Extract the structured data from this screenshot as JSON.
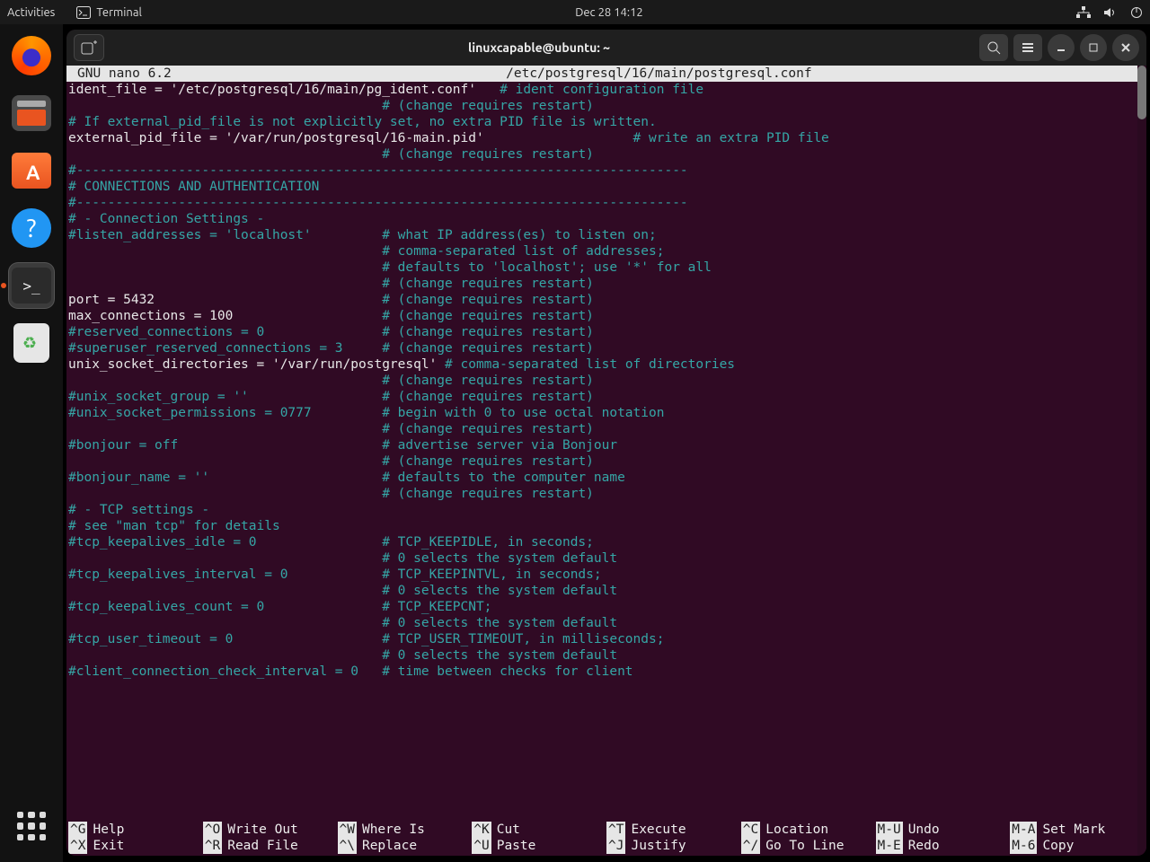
{
  "topbar": {
    "activities": "Activities",
    "app_label": "Terminal",
    "datetime": "Dec 28  14:12"
  },
  "dock": {
    "items": [
      {
        "name": "firefox-launcher"
      },
      {
        "name": "files-launcher"
      },
      {
        "name": "software-launcher"
      },
      {
        "name": "help-launcher"
      },
      {
        "name": "terminal-launcher"
      },
      {
        "name": "trash-launcher"
      }
    ]
  },
  "window": {
    "title": "linuxcapable@ubuntu: ~"
  },
  "nano": {
    "app": "  GNU nano  6.2",
    "filepath": "/etc/postgresql/16/main/postgresql.conf"
  },
  "lines": [
    {
      "segs": [
        [
          "plain",
          "ident_file = '/etc/postgresql/16/main/pg_ident.conf'   "
        ],
        [
          "comment",
          "# ident configuration file"
        ]
      ]
    },
    {
      "segs": [
        [
          "plain",
          "                                        "
        ],
        [
          "comment",
          "# (change requires restart)"
        ]
      ]
    },
    {
      "segs": [
        [
          "plain",
          ""
        ]
      ]
    },
    {
      "segs": [
        [
          "comment",
          "# If external_pid_file is not explicitly set, no extra PID file is written."
        ]
      ]
    },
    {
      "segs": [
        [
          "plain",
          "external_pid_file = '/var/run/postgresql/16-main.pid'                   "
        ],
        [
          "comment",
          "# write an extra PID file"
        ]
      ]
    },
    {
      "segs": [
        [
          "plain",
          "                                        "
        ],
        [
          "comment",
          "# (change requires restart)"
        ]
      ]
    },
    {
      "segs": [
        [
          "plain",
          ""
        ]
      ]
    },
    {
      "segs": [
        [
          "plain",
          ""
        ]
      ]
    },
    {
      "segs": [
        [
          "comment",
          "#------------------------------------------------------------------------------"
        ]
      ]
    },
    {
      "segs": [
        [
          "comment",
          "# CONNECTIONS AND AUTHENTICATION"
        ]
      ]
    },
    {
      "segs": [
        [
          "comment",
          "#------------------------------------------------------------------------------"
        ]
      ]
    },
    {
      "segs": [
        [
          "plain",
          ""
        ]
      ]
    },
    {
      "segs": [
        [
          "comment",
          "# - Connection Settings -"
        ]
      ]
    },
    {
      "segs": [
        [
          "plain",
          ""
        ]
      ]
    },
    {
      "segs": [
        [
          "comment",
          "#listen_addresses = 'localhost'         # what IP address(es) to listen on;"
        ]
      ]
    },
    {
      "segs": [
        [
          "plain",
          "                                        "
        ],
        [
          "comment",
          "# comma-separated list of addresses;"
        ]
      ]
    },
    {
      "segs": [
        [
          "plain",
          "                                        "
        ],
        [
          "comment",
          "# defaults to 'localhost'; use '*' for all"
        ]
      ]
    },
    {
      "segs": [
        [
          "plain",
          "                                        "
        ],
        [
          "comment",
          "# (change requires restart)"
        ]
      ]
    },
    {
      "segs": [
        [
          "plain",
          "port = 5432                             "
        ],
        [
          "comment",
          "# (change requires restart)"
        ]
      ]
    },
    {
      "segs": [
        [
          "plain",
          "max_connections = 100                   "
        ],
        [
          "comment",
          "# (change requires restart)"
        ]
      ]
    },
    {
      "segs": [
        [
          "comment",
          "#reserved_connections = 0               # (change requires restart)"
        ]
      ]
    },
    {
      "segs": [
        [
          "comment",
          "#superuser_reserved_connections = 3     # (change requires restart)"
        ]
      ]
    },
    {
      "segs": [
        [
          "plain",
          "unix_socket_directories = '/var/run/postgresql' "
        ],
        [
          "comment",
          "# comma-separated list of directories"
        ]
      ]
    },
    {
      "segs": [
        [
          "plain",
          "                                        "
        ],
        [
          "comment",
          "# (change requires restart)"
        ]
      ]
    },
    {
      "segs": [
        [
          "comment",
          "#unix_socket_group = ''                 # (change requires restart)"
        ]
      ]
    },
    {
      "segs": [
        [
          "comment",
          "#unix_socket_permissions = 0777         # begin with 0 to use octal notation"
        ]
      ]
    },
    {
      "segs": [
        [
          "plain",
          "                                        "
        ],
        [
          "comment",
          "# (change requires restart)"
        ]
      ]
    },
    {
      "segs": [
        [
          "comment",
          "#bonjour = off                          # advertise server via Bonjour"
        ]
      ]
    },
    {
      "segs": [
        [
          "plain",
          "                                        "
        ],
        [
          "comment",
          "# (change requires restart)"
        ]
      ]
    },
    {
      "segs": [
        [
          "comment",
          "#bonjour_name = ''                      # defaults to the computer name"
        ]
      ]
    },
    {
      "segs": [
        [
          "plain",
          "                                        "
        ],
        [
          "comment",
          "# (change requires restart)"
        ]
      ]
    },
    {
      "segs": [
        [
          "plain",
          ""
        ]
      ]
    },
    {
      "segs": [
        [
          "comment",
          "# - TCP settings -"
        ]
      ]
    },
    {
      "segs": [
        [
          "comment",
          "# see \"man tcp\" for details"
        ]
      ]
    },
    {
      "segs": [
        [
          "plain",
          ""
        ]
      ]
    },
    {
      "segs": [
        [
          "comment",
          "#tcp_keepalives_idle = 0                # TCP_KEEPIDLE, in seconds;"
        ]
      ]
    },
    {
      "segs": [
        [
          "plain",
          "                                        "
        ],
        [
          "comment",
          "# 0 selects the system default"
        ]
      ]
    },
    {
      "segs": [
        [
          "comment",
          "#tcp_keepalives_interval = 0            # TCP_KEEPINTVL, in seconds;"
        ]
      ]
    },
    {
      "segs": [
        [
          "plain",
          "                                        "
        ],
        [
          "comment",
          "# 0 selects the system default"
        ]
      ]
    },
    {
      "segs": [
        [
          "comment",
          "#tcp_keepalives_count = 0               # TCP_KEEPCNT;"
        ]
      ]
    },
    {
      "segs": [
        [
          "plain",
          "                                        "
        ],
        [
          "comment",
          "# 0 selects the system default"
        ]
      ]
    },
    {
      "segs": [
        [
          "comment",
          "#tcp_user_timeout = 0                   # TCP_USER_TIMEOUT, in milliseconds;"
        ]
      ]
    },
    {
      "segs": [
        [
          "plain",
          "                                        "
        ],
        [
          "comment",
          "# 0 selects the system default"
        ]
      ]
    },
    {
      "segs": [
        [
          "plain",
          ""
        ]
      ]
    },
    {
      "segs": [
        [
          "comment",
          "#client_connection_check_interval = 0   # time between checks for client"
        ]
      ]
    }
  ],
  "shortcuts_row1": [
    {
      "key": "^G",
      "label": "Help"
    },
    {
      "key": "^O",
      "label": "Write Out"
    },
    {
      "key": "^W",
      "label": "Where Is"
    },
    {
      "key": "^K",
      "label": "Cut"
    },
    {
      "key": "^T",
      "label": "Execute"
    },
    {
      "key": "^C",
      "label": "Location"
    },
    {
      "key": "M-U",
      "label": "Undo"
    },
    {
      "key": "M-A",
      "label": "Set Mark"
    }
  ],
  "shortcuts_row2": [
    {
      "key": "^X",
      "label": "Exit"
    },
    {
      "key": "^R",
      "label": "Read File"
    },
    {
      "key": "^\\",
      "label": "Replace"
    },
    {
      "key": "^U",
      "label": "Paste"
    },
    {
      "key": "^J",
      "label": "Justify"
    },
    {
      "key": "^/",
      "label": "Go To Line"
    },
    {
      "key": "M-E",
      "label": "Redo"
    },
    {
      "key": "M-6",
      "label": "Copy"
    }
  ]
}
